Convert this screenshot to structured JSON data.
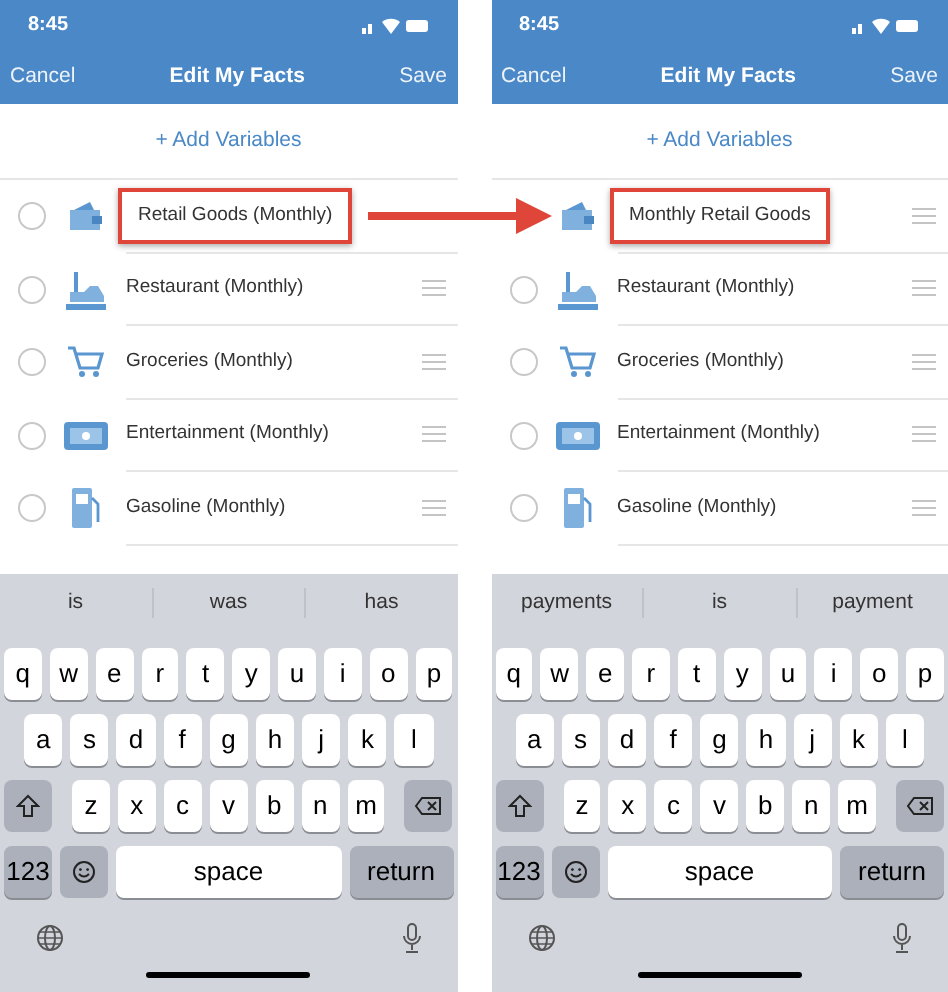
{
  "screens": [
    {
      "status": {
        "time": "8:45"
      },
      "nav": {
        "cancel": "Cancel",
        "title": "Edit My Facts",
        "save": "Save"
      },
      "add_button": "+ Add Variables",
      "rows": [
        {
          "label": "Retail Goods (Monthly)",
          "kind": "wallet",
          "radio_shown": true,
          "selected": false,
          "handle": false,
          "highlighted": true
        },
        {
          "label": "Restaurant (Monthly)",
          "kind": "building",
          "radio_shown": true,
          "selected": false,
          "handle": true,
          "highlighted": false
        },
        {
          "label": "Groceries (Monthly)",
          "kind": "cart",
          "radio_shown": true,
          "selected": false,
          "handle": true,
          "highlighted": false
        },
        {
          "label": "Entertainment (Monthly)",
          "kind": "ticket",
          "radio_shown": true,
          "selected": false,
          "handle": true,
          "highlighted": false
        },
        {
          "label": "Gasoline (Monthly)",
          "kind": "pump",
          "radio_shown": true,
          "selected": false,
          "handle": true,
          "highlighted": false
        }
      ],
      "keyboard": {
        "suggestions": [
          "is",
          "was",
          "has"
        ],
        "rows": [
          [
            "q",
            "w",
            "e",
            "r",
            "t",
            "y",
            "u",
            "i",
            "o",
            "p"
          ],
          [
            "a",
            "s",
            "d",
            "f",
            "g",
            "h",
            "j",
            "k",
            "l"
          ],
          [
            "z",
            "x",
            "c",
            "v",
            "b",
            "n",
            "m"
          ]
        ],
        "numbers": "123",
        "space": "space",
        "return": "return"
      }
    },
    {
      "status": {
        "time": "8:45"
      },
      "nav": {
        "cancel": "Cancel",
        "title": "Edit My Facts",
        "save": "Save"
      },
      "add_button": "+ Add Variables",
      "rows": [
        {
          "label": "Monthly Retail Goods",
          "kind": "wallet",
          "radio_shown": false,
          "selected": false,
          "handle": true,
          "highlighted": true
        },
        {
          "label": "Restaurant (Monthly)",
          "kind": "building",
          "radio_shown": true,
          "selected": false,
          "handle": true,
          "highlighted": false
        },
        {
          "label": "Groceries (Monthly)",
          "kind": "cart",
          "radio_shown": true,
          "selected": false,
          "handle": true,
          "highlighted": false
        },
        {
          "label": "Entertainment (Monthly)",
          "kind": "ticket",
          "radio_shown": true,
          "selected": false,
          "handle": true,
          "highlighted": false
        },
        {
          "label": "Gasoline (Monthly)",
          "kind": "pump",
          "radio_shown": true,
          "selected": false,
          "handle": true,
          "highlighted": false
        }
      ],
      "keyboard": {
        "suggestions": [
          "payments",
          "is",
          "payment"
        ],
        "rows": [
          [
            "q",
            "w",
            "e",
            "r",
            "t",
            "y",
            "u",
            "i",
            "o",
            "p"
          ],
          [
            "a",
            "s",
            "d",
            "f",
            "g",
            "h",
            "j",
            "k",
            "l"
          ],
          [
            "z",
            "x",
            "c",
            "v",
            "b",
            "n",
            "m"
          ]
        ],
        "numbers": "123",
        "space": "space",
        "return": "return"
      }
    }
  ]
}
